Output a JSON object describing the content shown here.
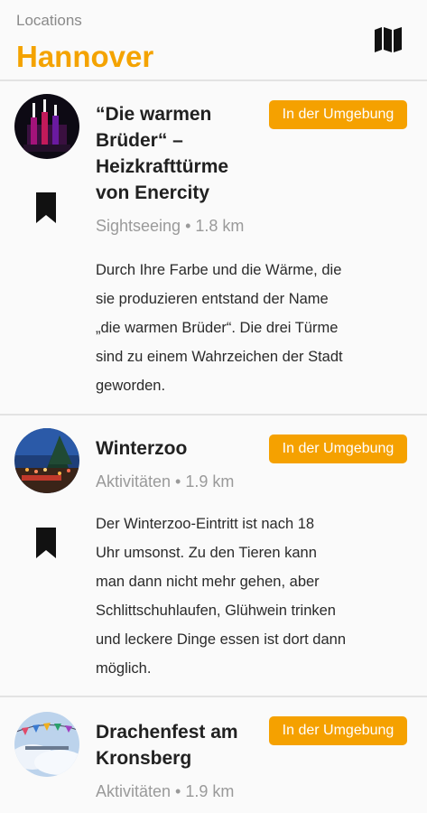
{
  "header": {
    "section_label": "Locations",
    "city": "Hannover",
    "map_icon": "map-icon"
  },
  "colors": {
    "accent": "#f4a300",
    "badge": "#f5a100",
    "text": "#212121",
    "muted": "#9a9a9a"
  },
  "locations": [
    {
      "title_lines": [
        "“Die warmen",
        "Brüder“ –",
        "Heizkrafttürme",
        "von Enercity"
      ],
      "badge": "In der Umgebung",
      "meta": "Sightseeing • 1.8 km",
      "description_lines": [
        "Durch Ihre Farbe und die Wärme, die",
        "sie produzieren entstand der Name",
        "„die warmen Brüder“. Die drei Türme",
        "sind zu einem Wahrzeichen der Stadt",
        "geworden."
      ]
    },
    {
      "title_lines": [
        "Winterzoo"
      ],
      "badge": "In der Umgebung",
      "meta": "Aktivitäten • 1.9 km",
      "description_lines": [
        "Der Winterzoo-Eintritt ist nach 18",
        "Uhr umsonst. Zu den Tieren kann",
        "man dann nicht mehr gehen, aber",
        "Schlittschuhlaufen, Glühwein trinken",
        "und leckere Dinge essen ist dort dann",
        "möglich."
      ]
    },
    {
      "title_lines": [
        "Drachenfest am",
        "Kronsberg"
      ],
      "badge": "In der Umgebung",
      "meta": "Aktivitäten • 1.9 km",
      "description_lines": []
    }
  ]
}
